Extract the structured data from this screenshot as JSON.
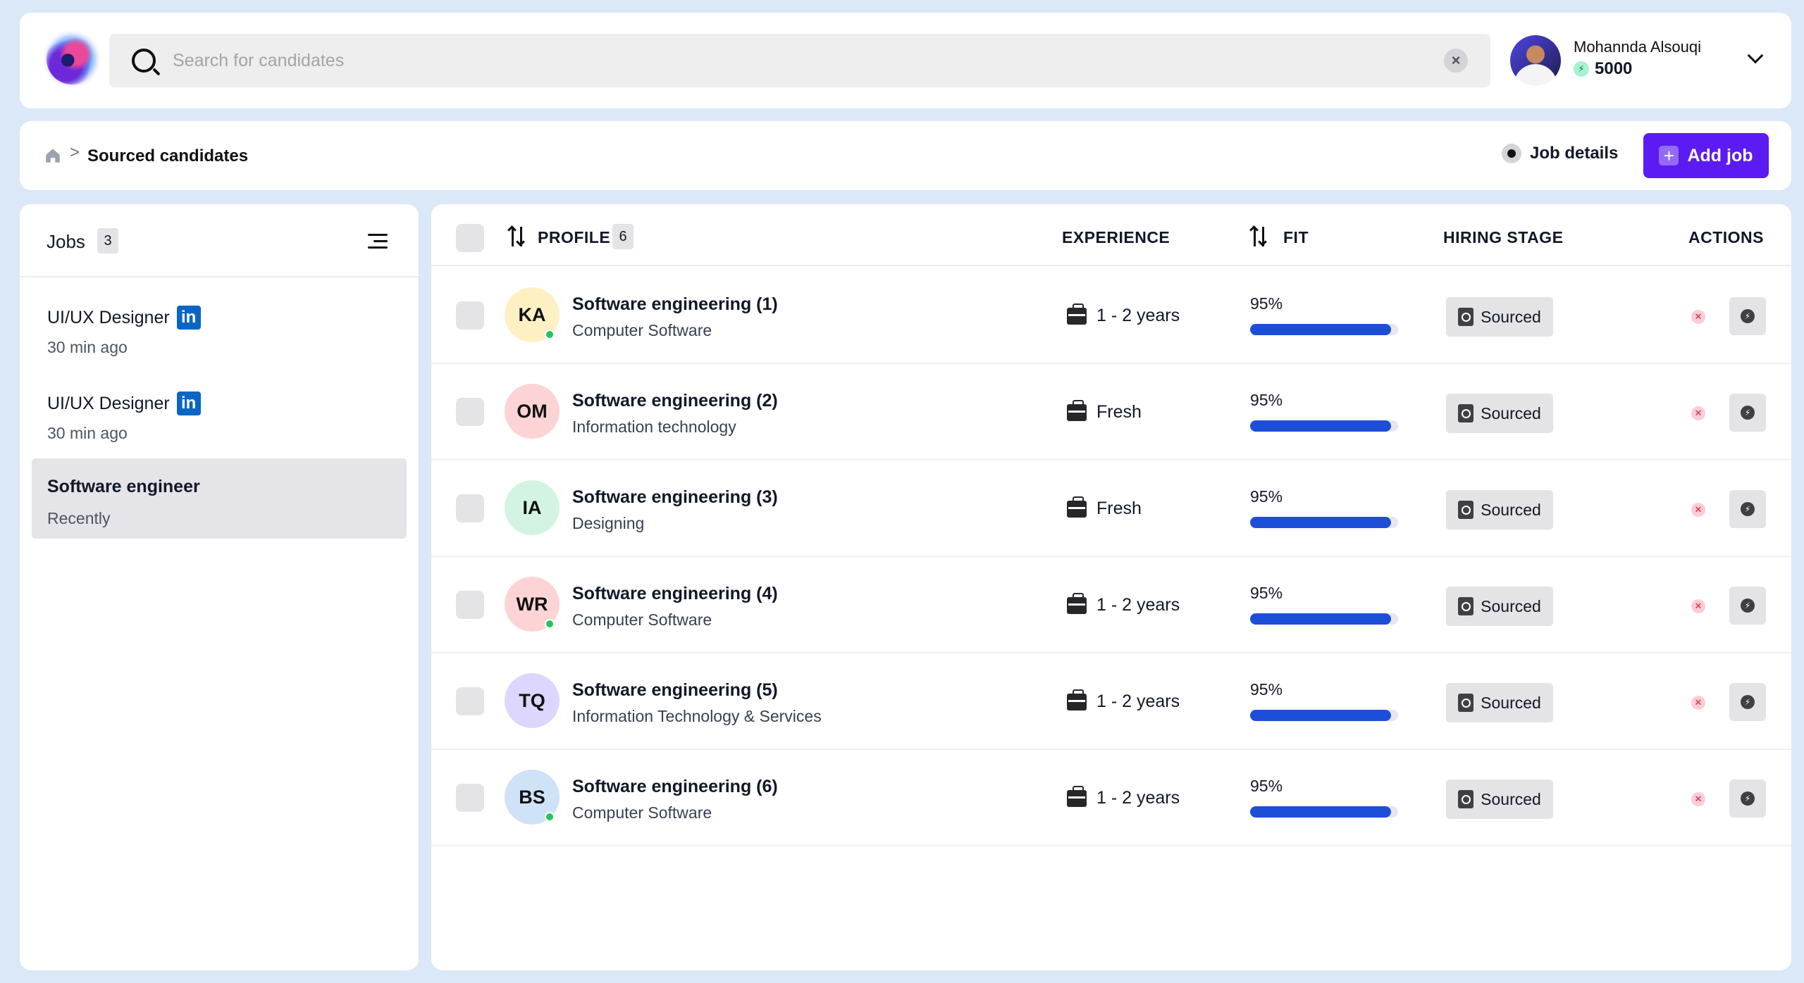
{
  "search": {
    "placeholder": "Search for candidates",
    "value": ""
  },
  "user": {
    "name": "Mohannda Alsouqi",
    "credits": "5000"
  },
  "breadcrumb": {
    "separator": ">",
    "current": "Sourced candidates"
  },
  "actions_bar": {
    "job_details": "Job details",
    "add_job": "Add job",
    "add_icon": "+"
  },
  "jobs": {
    "title": "Jobs",
    "count": "3",
    "items": [
      {
        "title": "UI/UX Designer",
        "time": "30 min ago",
        "linkedin": "in"
      },
      {
        "title": "UI/UX Designer",
        "time": "30 min ago",
        "linkedin": "in"
      },
      {
        "title": "Software engineer",
        "time": "Recently"
      }
    ]
  },
  "table": {
    "headers": {
      "profile": "PROFILE",
      "profile_count": "6",
      "experience": "EXPERIENCE",
      "fit": "FIT",
      "hiring_stage": "HIRING STAGE",
      "actions": "ACTIONS"
    },
    "rows": [
      {
        "initials": "KA",
        "name": "Software engineering (1)",
        "industry": "Computer Software",
        "experience": "1 - 2 years",
        "fit_label": "95%",
        "fit": 0.95,
        "stage": "Sourced",
        "online": true,
        "avatar_color": "#fdf1c4"
      },
      {
        "initials": "OM",
        "name": "Software engineering (2)",
        "industry": "Information technology",
        "experience": "Fresh",
        "fit_label": "95%",
        "fit": 0.95,
        "stage": "Sourced",
        "online": false,
        "avatar_color": "#fdd4d6"
      },
      {
        "initials": "IA",
        "name": "Software engineering (3)",
        "industry": "Designing",
        "experience": "Fresh",
        "fit_label": "95%",
        "fit": 0.95,
        "stage": "Sourced",
        "online": false,
        "avatar_color": "#d3f4e3"
      },
      {
        "initials": "WR",
        "name": "Software engineering (4)",
        "industry": "Computer Software",
        "experience": "1 - 2 years",
        "fit_label": "95%",
        "fit": 0.95,
        "stage": "Sourced",
        "online": true,
        "avatar_color": "#fdd4d6"
      },
      {
        "initials": "TQ",
        "name": "Software engineering (5)",
        "industry": "Information Technology & Services",
        "experience": "1 - 2 years",
        "fit_label": "95%",
        "fit": 0.95,
        "stage": "Sourced",
        "online": false,
        "avatar_color": "#ddd6fe"
      },
      {
        "initials": "BS",
        "name": "Software engineering (6)",
        "industry": "Computer Software",
        "experience": "1 - 2 years",
        "fit_label": "95%",
        "fit": 0.95,
        "stage": "Sourced",
        "online": true,
        "avatar_color": "#cfe2f8"
      }
    ]
  },
  "icons": {
    "reject": "✕",
    "clear": "×",
    "bolt": "⚡"
  },
  "colors": {
    "accent": "#5b1bf2",
    "fit_bar": "#1d4ed8",
    "background": "#dae8f7",
    "linkedin": "#0a66c2"
  }
}
